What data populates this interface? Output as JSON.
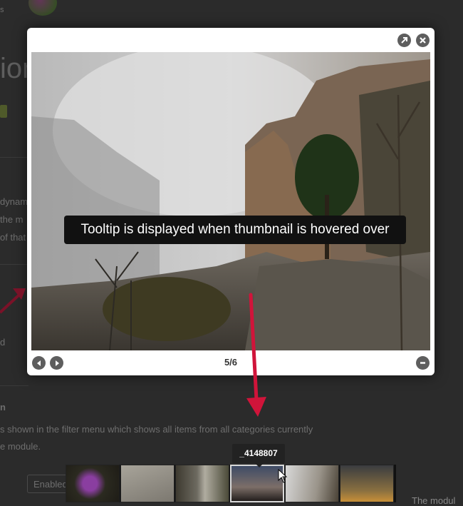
{
  "background": {
    "heading_fragment": "ion",
    "top_fragment": "s",
    "fragments": [
      "dynam",
      "the m",
      "of that",
      "d"
    ],
    "section_heading_fragment": "n",
    "paragraph_1": "s shown in the filter menu which shows all items from all categories currently",
    "paragraph_2": "e module.",
    "select_value": "Enabled",
    "right_fragment": "The modul"
  },
  "lightbox": {
    "counter": "5/6",
    "tooltip": "Tooltip is displayed when thumbnail is hovered over"
  },
  "thumbnails": {
    "hover_tooltip": "_4148807",
    "count": 6,
    "active_index": 4
  },
  "icons": {
    "expand": "expand-icon",
    "close": "close-icon",
    "prev": "prev-arrow-icon",
    "next": "next-arrow-icon",
    "minimize": "minus-icon"
  },
  "colors": {
    "annotation_arrow": "#d0143a",
    "overlay": "#2b2b2b",
    "lightbox_bg": "#ffffff",
    "button_gray": "#5e5e5e"
  }
}
